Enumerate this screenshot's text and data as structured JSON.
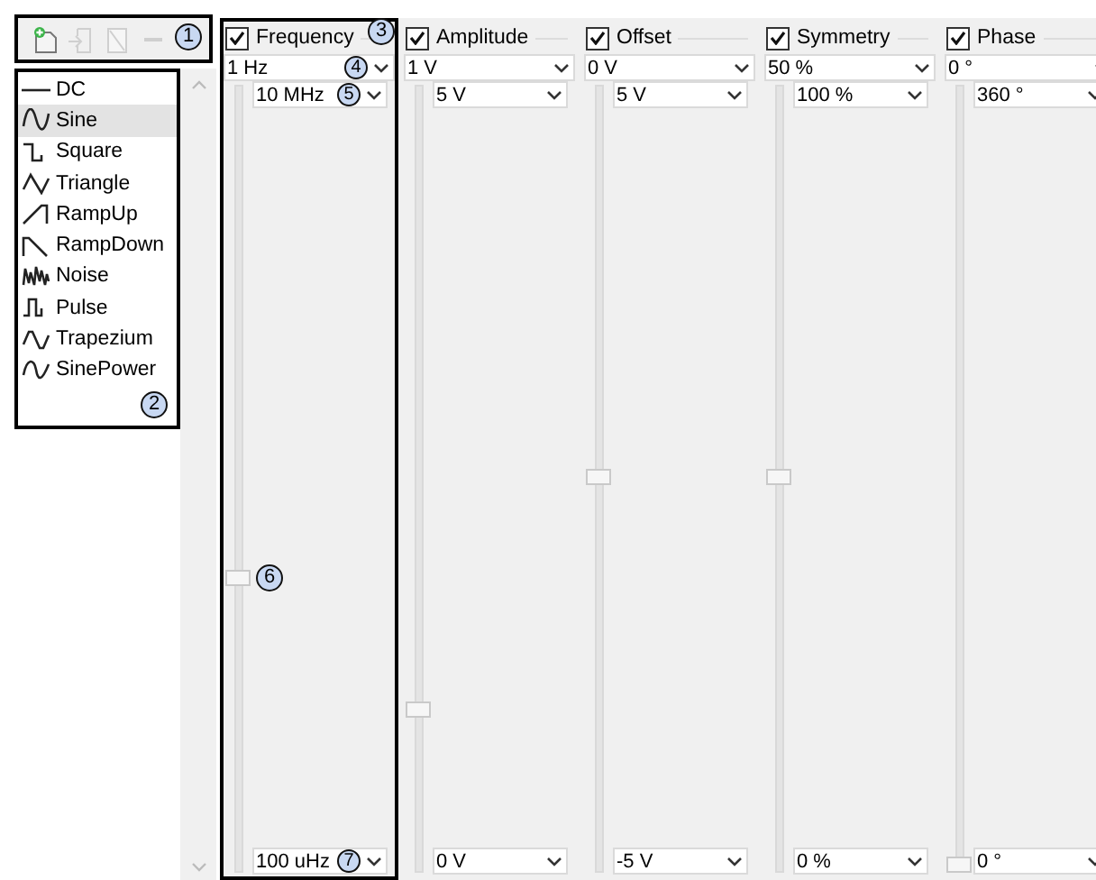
{
  "toolbar": {
    "outlined": true,
    "callout": "1",
    "buttons": [
      {
        "kind": "add",
        "disabled": false
      },
      {
        "kind": "import",
        "disabled": true
      },
      {
        "kind": "edit",
        "disabled": true
      },
      {
        "kind": "remove",
        "disabled": true
      }
    ]
  },
  "wave_list": {
    "outlined": true,
    "callout": "2",
    "items": [
      {
        "kind": "dc",
        "label": "DC",
        "selected": false
      },
      {
        "kind": "sine",
        "label": "Sine",
        "selected": true
      },
      {
        "kind": "square",
        "label": "Square",
        "selected": false
      },
      {
        "kind": "triangle",
        "label": "Triangle",
        "selected": false
      },
      {
        "kind": "rampup",
        "label": "RampUp",
        "selected": false
      },
      {
        "kind": "rampdown",
        "label": "RampDown",
        "selected": false
      },
      {
        "kind": "noise",
        "label": "Noise",
        "selected": false
      },
      {
        "kind": "pulse",
        "label": "Pulse",
        "selected": false
      },
      {
        "kind": "trapezium",
        "label": "Trapezium",
        "selected": false
      },
      {
        "kind": "sinepower",
        "label": "SinePower",
        "selected": false
      }
    ]
  },
  "columns": [
    {
      "label": "Frequency",
      "checked": true,
      "outlined": true,
      "callout": "3",
      "value": "1 Hz",
      "value_callout": "4",
      "max": "10 MHz",
      "max_callout": "5",
      "level": 0.37,
      "slider_callout": "6",
      "min": "100 uHz",
      "min_callout": "7"
    },
    {
      "label": "Amplitude",
      "checked": true,
      "outlined": false,
      "value": "1 V",
      "max": "5 V",
      "level": 0.2,
      "min": "0 V"
    },
    {
      "label": "Offset",
      "checked": true,
      "outlined": false,
      "value": "0 V",
      "max": "5 V",
      "level": 0.5,
      "min": "-5 V"
    },
    {
      "label": "Symmetry",
      "checked": true,
      "outlined": false,
      "value": "50 %",
      "max": "100 %",
      "level": 0.5,
      "min": "0 %"
    },
    {
      "label": "Phase",
      "checked": true,
      "outlined": false,
      "value": "0 °",
      "max": "360 °",
      "level": 0,
      "min": "0 °"
    }
  ]
}
